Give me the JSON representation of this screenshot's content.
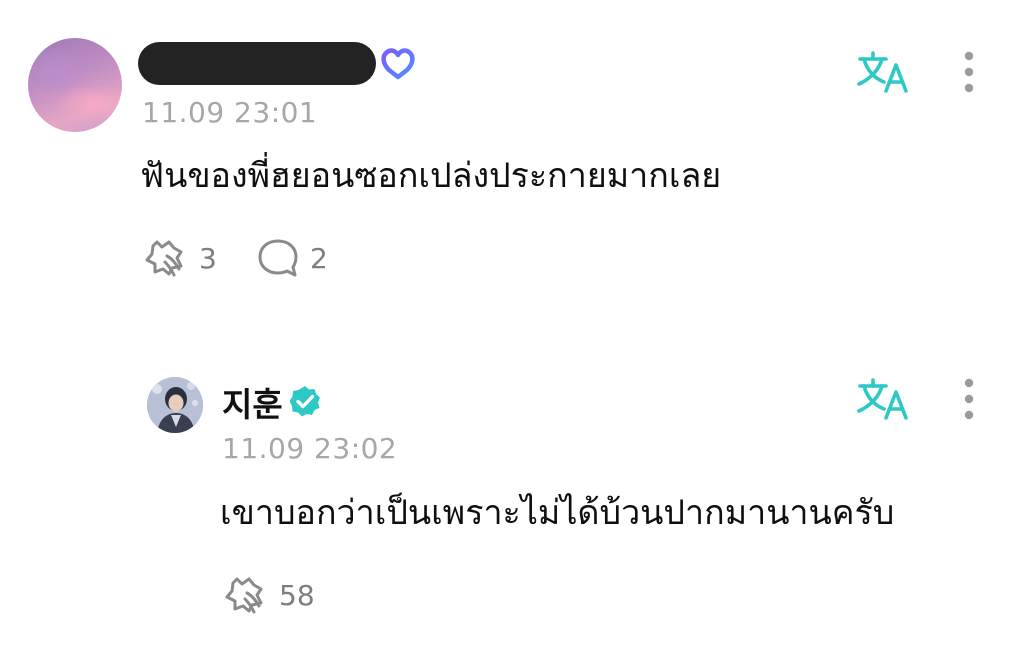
{
  "comment": {
    "timestamp": "11.09 23:01",
    "text": "ฟันของพี่ฮยอนซอกเปล่งประกายมากเลย",
    "like_count": "3",
    "reply_count": "2",
    "avatar_colors": [
      "#9c7ab6",
      "#e5a6c4"
    ]
  },
  "reply": {
    "author": "지훈",
    "timestamp": "11.09 23:02",
    "text": "เขาบอกว่าเป็นเพราะไม่ได้บ้วนปากมานานครับ",
    "like_count": "58"
  },
  "icons": {
    "translate": "translate-icon",
    "more": "more-vertical-icon",
    "like": "like-hands-icon",
    "comment": "comment-bubble-icon",
    "verified": "verified-badge-icon",
    "membership": "membership-heart-icon"
  },
  "colors": {
    "accent": "#2dc9c4",
    "verified": "#2dc9c4",
    "timestamp": "#a7a7a7",
    "count": "#7e7e7e",
    "redaction": "#232323"
  }
}
